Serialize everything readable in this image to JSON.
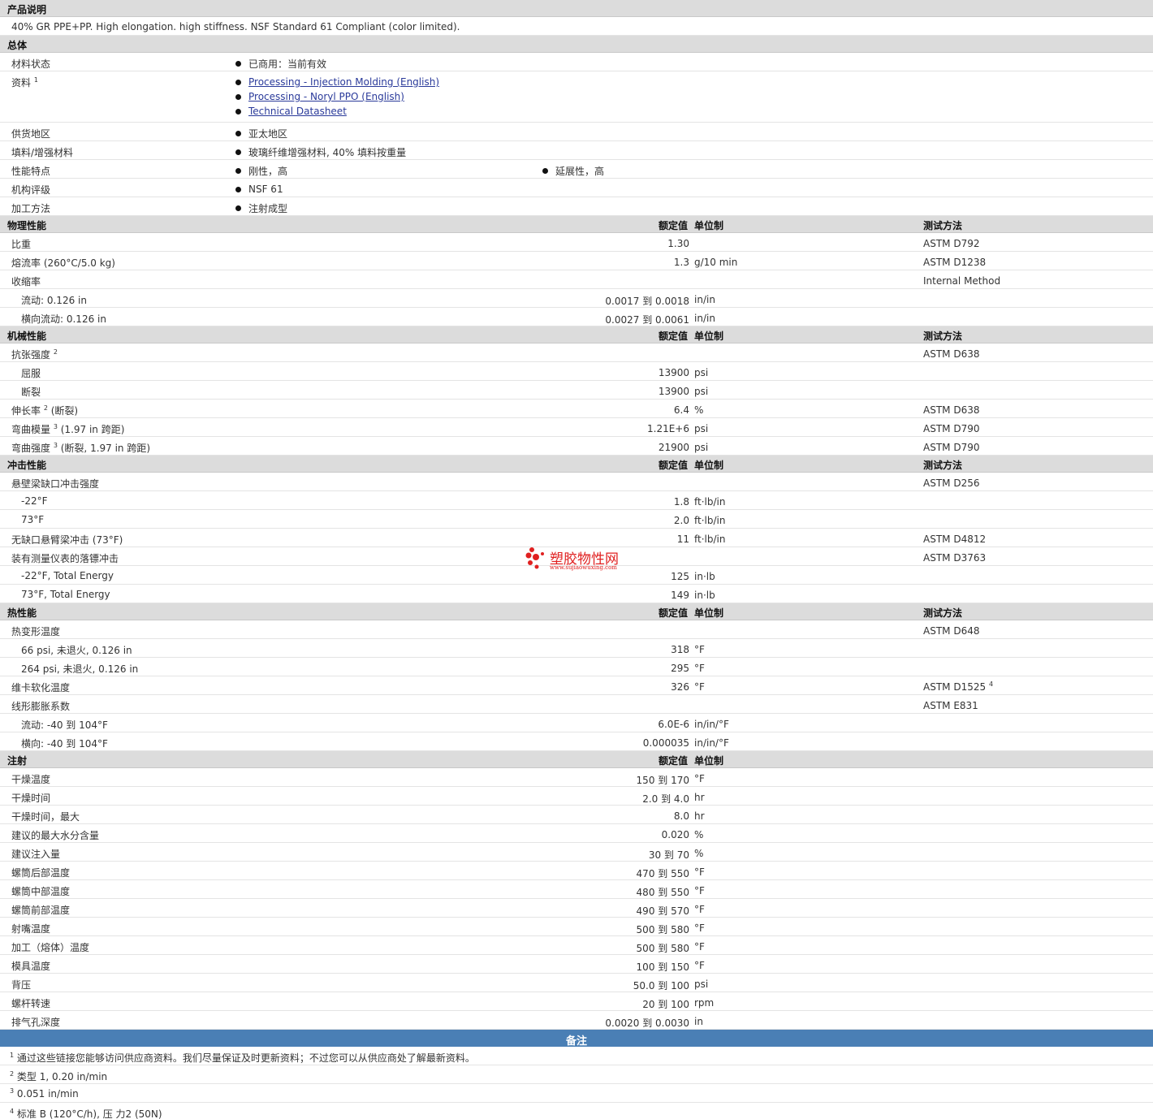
{
  "description": {
    "title": "产品说明",
    "text": "40% GR PPE+PP. High elongation. high stiffness. NSF Standard 61 Compliant (color limited)."
  },
  "general": {
    "title": "总体",
    "rows": [
      {
        "label": "材料状态",
        "items": [
          "已商用：当前有效"
        ]
      },
      {
        "label": "资料",
        "sup": "1",
        "links": [
          "Processing - Injection Molding (English)",
          "Processing - Noryl PPO (English)",
          "Technical Datasheet"
        ]
      },
      {
        "label": "供货地区",
        "items": [
          "亚太地区"
        ]
      },
      {
        "label": "填料/增强材料",
        "items": [
          "玻璃纤维增强材料, 40% 填料按重量"
        ]
      },
      {
        "label": "性能特点",
        "items": [
          "刚性，高"
        ],
        "items2": [
          "延展性，高"
        ]
      },
      {
        "label": "机构评级",
        "items": [
          "NSF 61"
        ]
      },
      {
        "label": "加工方法",
        "items": [
          "注射成型"
        ]
      }
    ]
  },
  "headers": {
    "nominal": "额定值",
    "unit": "单位制",
    "test": "测试方法"
  },
  "sections": [
    {
      "title": "物理性能",
      "has_test": true,
      "rows": [
        {
          "label": "比重",
          "val": "1.30",
          "unit": "",
          "test": "ASTM D792"
        },
        {
          "label": "熔流率  (260°C/5.0 kg)",
          "val": "1.3",
          "unit": "g/10 min",
          "test": "ASTM D1238"
        },
        {
          "label": "收缩率",
          "val": "",
          "unit": "",
          "test": "Internal Method"
        },
        {
          "label": "流动: 0.126 in",
          "sub": true,
          "val": "0.0017 到  0.0018",
          "unit": "in/in",
          "test": ""
        },
        {
          "label": "横向流动: 0.126 in",
          "sub": true,
          "val": "0.0027 到  0.0061",
          "unit": "in/in",
          "test": ""
        }
      ]
    },
    {
      "title": "机械性能",
      "has_test": true,
      "rows": [
        {
          "label": "抗张强度",
          "sup": "2",
          "val": "",
          "unit": "",
          "test": "ASTM D638"
        },
        {
          "label": "屈服",
          "sub": true,
          "val": "13900",
          "unit": "psi",
          "test": ""
        },
        {
          "label": "断裂",
          "sub": true,
          "val": "13900",
          "unit": "psi",
          "test": ""
        },
        {
          "label": "伸长率",
          "sup": "2",
          "after": " (断裂)",
          "val": "6.4",
          "unit": "%",
          "test": "ASTM D638"
        },
        {
          "label": "弯曲模量",
          "sup": "3",
          "after": " (1.97 in 跨距)",
          "val": "1.21E+6",
          "unit": "psi",
          "test": "ASTM D790"
        },
        {
          "label": "弯曲强度",
          "sup": "3",
          "after": " (断裂, 1.97 in 跨距)",
          "val": "21900",
          "unit": "psi",
          "test": "ASTM D790"
        }
      ]
    },
    {
      "title": "冲击性能",
      "has_test": true,
      "rows": [
        {
          "label": "悬壁梁缺口冲击强度",
          "val": "",
          "unit": "",
          "test": "ASTM D256"
        },
        {
          "label": "-22°F",
          "sub": true,
          "val": "1.8",
          "unit": "ft·lb/in",
          "test": ""
        },
        {
          "label": "73°F",
          "sub": true,
          "val": "2.0",
          "unit": "ft·lb/in",
          "test": ""
        },
        {
          "label": "无缺口悬臂梁冲击  (73°F)",
          "val": "11",
          "unit": "ft·lb/in",
          "test": "ASTM D4812"
        },
        {
          "label": "装有测量仪表的落镖冲击",
          "val": "",
          "unit": "",
          "test": "ASTM D3763"
        },
        {
          "label": "-22°F, Total Energy",
          "sub": true,
          "val": "125",
          "unit": "in·lb",
          "test": ""
        },
        {
          "label": "73°F, Total Energy",
          "sub": true,
          "val": "149",
          "unit": "in·lb",
          "test": ""
        }
      ]
    },
    {
      "title": "热性能",
      "has_test": true,
      "rows": [
        {
          "label": "热变形温度",
          "val": "",
          "unit": "",
          "test": "ASTM D648"
        },
        {
          "label": "66 psi, 未退火, 0.126 in",
          "sub": true,
          "val": "318",
          "unit": "°F",
          "test": ""
        },
        {
          "label": "264 psi, 未退火, 0.126 in",
          "sub": true,
          "val": "295",
          "unit": "°F",
          "test": ""
        },
        {
          "label": "维卡软化温度",
          "val": "326",
          "unit": "°F",
          "test": "ASTM D1525",
          "test_sup": "4"
        },
        {
          "label": "线形膨胀系数",
          "val": "",
          "unit": "",
          "test": "ASTM E831"
        },
        {
          "label": "流动: -40 到  104°F",
          "sub": true,
          "val": "6.0E-6",
          "unit": "in/in/°F",
          "test": ""
        },
        {
          "label": "横向: -40 到  104°F",
          "sub": true,
          "val": "0.000035",
          "unit": "in/in/°F",
          "test": ""
        }
      ]
    },
    {
      "title": "注射",
      "has_test": false,
      "rows": [
        {
          "label": "干燥温度",
          "val": "150 到  170",
          "unit": "°F",
          "test": ""
        },
        {
          "label": "干燥时间",
          "val": "2.0 到  4.0",
          "unit": "hr",
          "test": ""
        },
        {
          "label": "干燥时间，最大",
          "val": "8.0",
          "unit": "hr",
          "test": ""
        },
        {
          "label": "建议的最大水分含量",
          "val": "0.020",
          "unit": "%",
          "test": ""
        },
        {
          "label": "建议注入量",
          "val": "30 到  70",
          "unit": "%",
          "test": ""
        },
        {
          "label": "螺筒后部温度",
          "val": "470 到  550",
          "unit": "°F",
          "test": ""
        },
        {
          "label": "螺筒中部温度",
          "val": "480 到  550",
          "unit": "°F",
          "test": ""
        },
        {
          "label": "螺筒前部温度",
          "val": "490 到  570",
          "unit": "°F",
          "test": ""
        },
        {
          "label": "射嘴温度",
          "val": "500 到  580",
          "unit": "°F",
          "test": ""
        },
        {
          "label": "加工（熔体）温度",
          "val": "500 到  580",
          "unit": "°F",
          "test": ""
        },
        {
          "label": "模具温度",
          "val": "100 到  150",
          "unit": "°F",
          "test": ""
        },
        {
          "label": "背压",
          "val": "50.0 到  100",
          "unit": "psi",
          "test": ""
        },
        {
          "label": "螺杆转速",
          "val": "20 到  100",
          "unit": "rpm",
          "test": ""
        },
        {
          "label": "排气孔深度",
          "val": "0.0020 到  0.0030",
          "unit": "in",
          "test": ""
        }
      ]
    }
  ],
  "notes": {
    "title": "备注",
    "items": [
      {
        "num": "1",
        "text": "通过这些链接您能够访问供应商资料。我们尽量保证及时更新资料；不过您可以从供应商处了解最新资料。"
      },
      {
        "num": "2",
        "text": "类型  1, 0.20 in/min"
      },
      {
        "num": "3",
        "text": "0.051 in/min"
      },
      {
        "num": "4",
        "text": "标准  B (120°C/h), 压  力2 (50N)"
      }
    ]
  },
  "watermark": {
    "text": "塑胶物性网",
    "url": "www.sujiaowuxing.com",
    "color": "#e02020"
  },
  "colors": {
    "section_bg": "#dcdcdc",
    "notes_bg": "#4a7fb5",
    "link": "#2a3a9a"
  }
}
